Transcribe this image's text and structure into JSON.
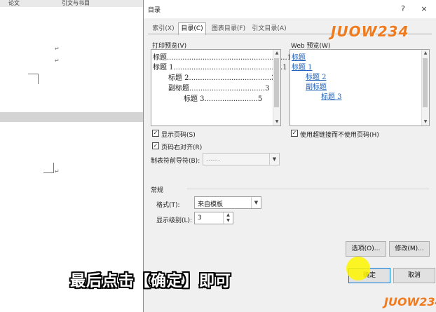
{
  "background": {
    "ribbon_tabs": [
      "论文",
      "引文与书目"
    ],
    "paragraph_mark": "↵"
  },
  "dialog": {
    "title": "目录",
    "help_icon": "question-icon",
    "help_symbol": "?",
    "close_icon": "close-icon",
    "close_symbol": "×",
    "tabs": [
      {
        "label": "索引(X)",
        "active": false
      },
      {
        "label": "目录(C)",
        "active": true
      },
      {
        "label": "图表目录(F)",
        "active": false
      },
      {
        "label": "引文目录(A)",
        "active": false
      }
    ],
    "print_preview": {
      "label": "打印预览(V)",
      "lines": [
        {
          "text": "标题......................................................1"
        },
        {
          "text": "标题 1.................................................1"
        },
        {
          "text": "标题 2.....................................3"
        },
        {
          "text": "副标题..................................3"
        },
        {
          "text": "标题 3........................5"
        }
      ]
    },
    "web_preview": {
      "label": "Web 预览(W)",
      "lines": [
        "标题",
        "标题 1",
        "标题 2",
        "副标题",
        "标题 3"
      ]
    },
    "options": {
      "show_page_numbers": {
        "label": "显示页码(S)",
        "checked": true
      },
      "right_align": {
        "label": "页码右对齐(R)",
        "checked": true
      },
      "use_hyperlinks": {
        "label": "使用超链接而不使用页码(H)",
        "checked": true
      },
      "check_symbol": "✓"
    },
    "tab_leader": {
      "label": "制表符前导符(B):",
      "value": "......."
    },
    "general": {
      "label": "常规",
      "format": {
        "label": "格式(T):",
        "value": "来自模板"
      },
      "levels": {
        "label": "显示级别(L):",
        "value": "3"
      }
    },
    "buttons": {
      "options": "选项(O)...",
      "modify": "修改(M)...",
      "ok": "确定",
      "cancel": "取消"
    },
    "dropdown_symbol": "▼",
    "spinner_up": "▲",
    "spinner_down": "▼",
    "scroll_up": "▲",
    "scroll_down": "▼"
  },
  "overlay": {
    "caption": "最后点击【确定】即可",
    "logo": "JUOW234",
    "logo_color": "#f07b1f",
    "highlight_color": "#fff500"
  }
}
